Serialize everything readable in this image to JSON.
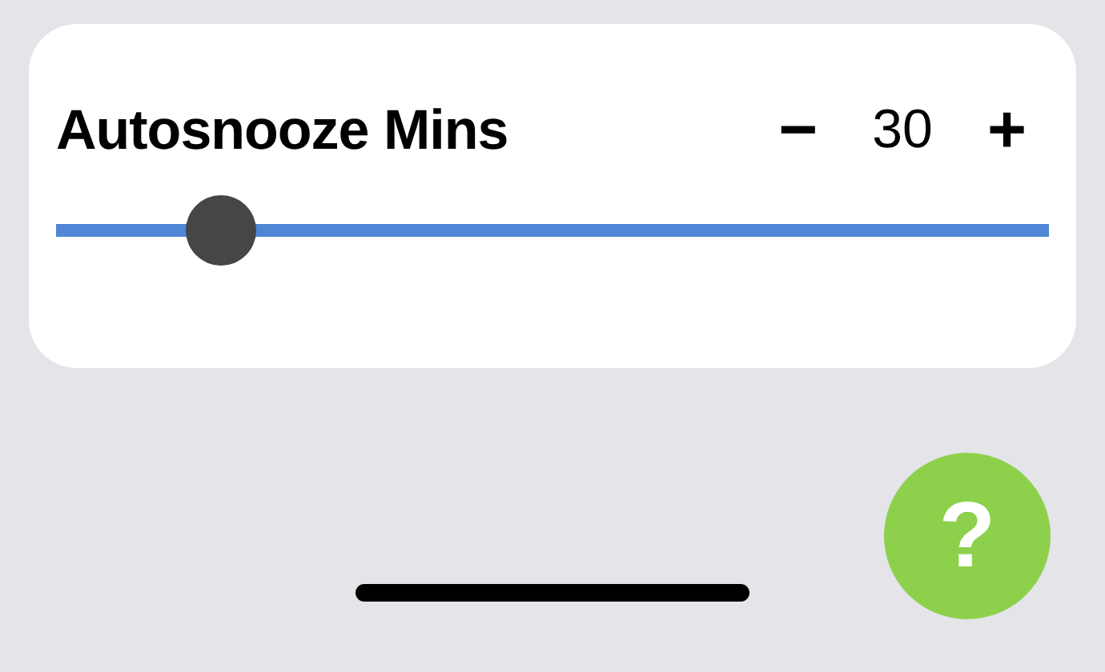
{
  "setting": {
    "label": "Autosnooze Mins",
    "decrement": "−",
    "value": "30",
    "increment": "+",
    "slider": {
      "level": 0.166
    }
  },
  "help_button": {
    "label": "?"
  }
}
